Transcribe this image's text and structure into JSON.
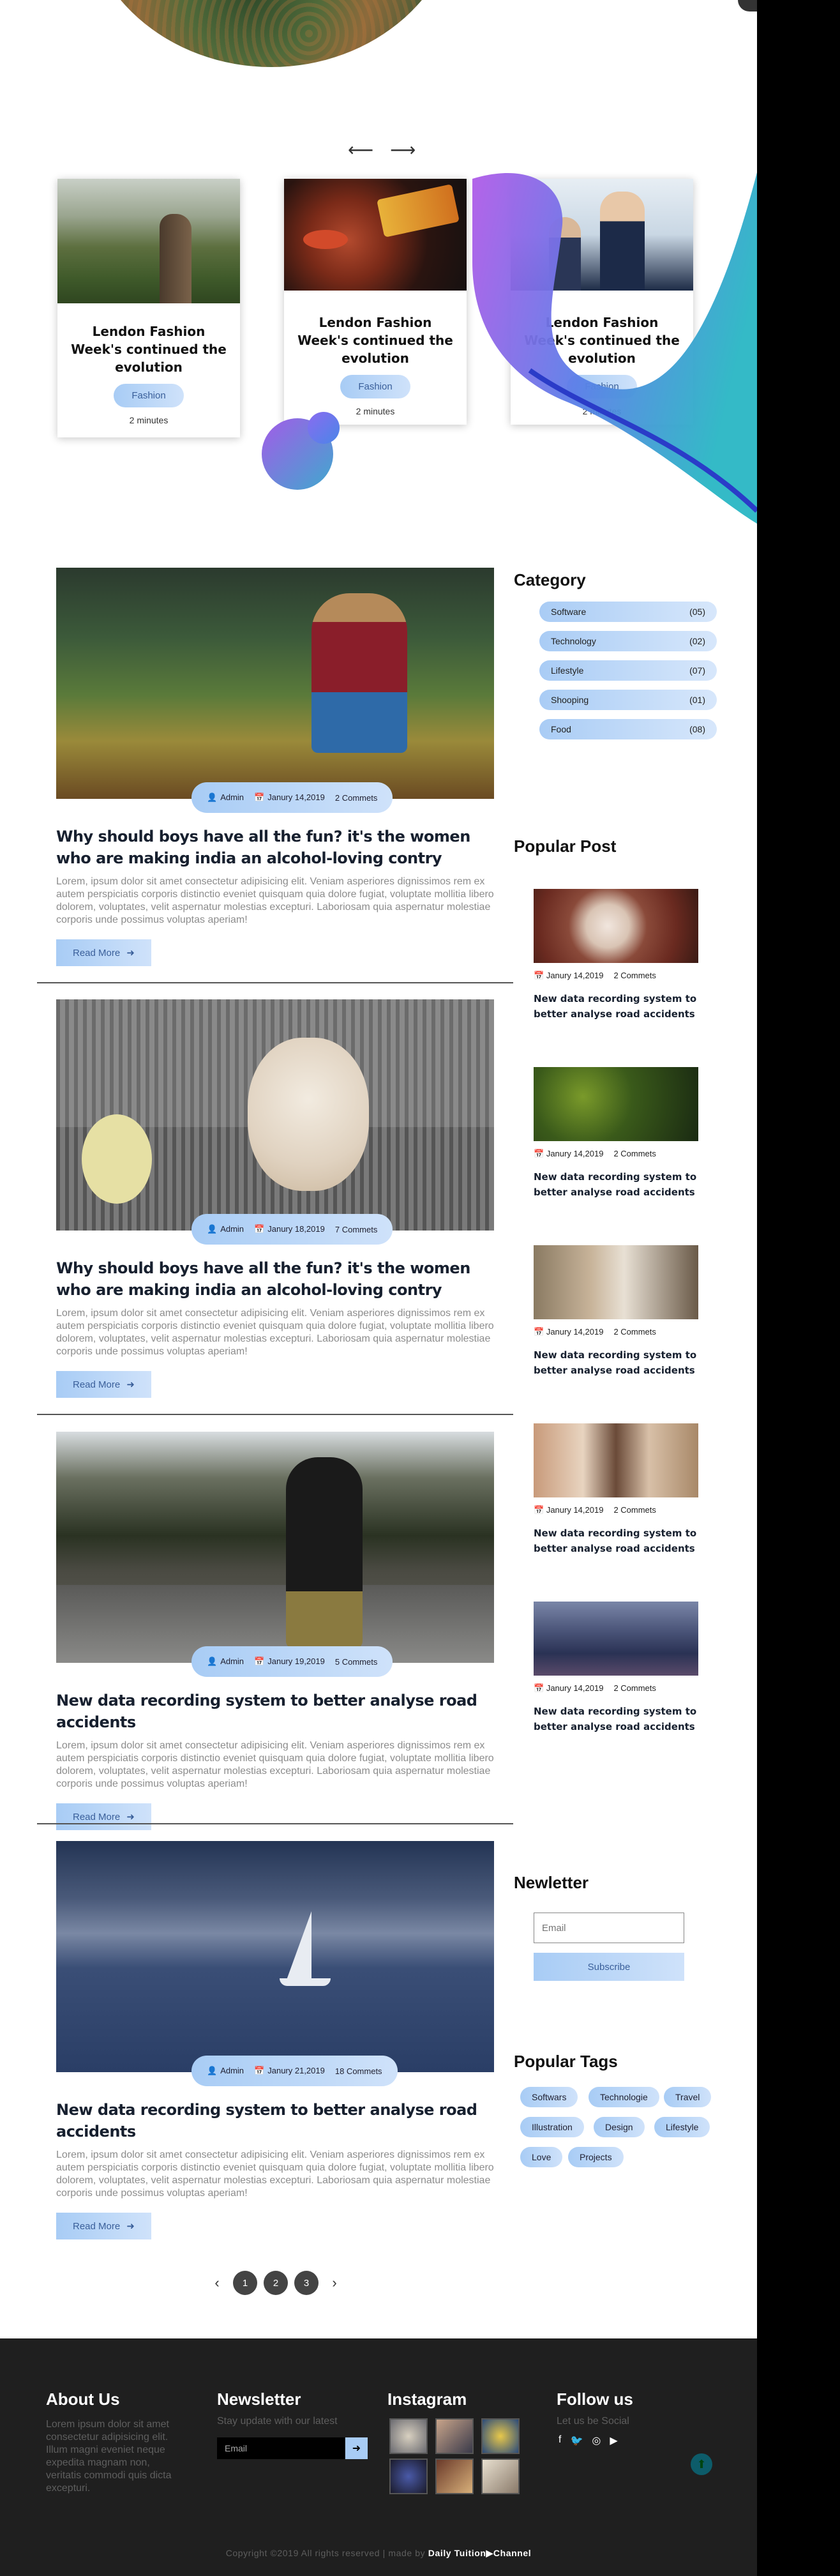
{
  "slider": {
    "prev": "⟵",
    "next": "⟶",
    "cards": [
      {
        "title": "Lendon Fashion Week's continued the evolution",
        "tag": "Fashion",
        "time": "2 minutes"
      },
      {
        "title": "Lendon Fashion Week's continued the evolution",
        "tag": "Fashion",
        "time": "2 minutes"
      },
      {
        "title": "Lendon Fashion Week's continued the evolution",
        "tag": "Fashion",
        "time": "2 minutes"
      }
    ]
  },
  "posts": [
    {
      "author": "Admin",
      "date": "Janury 14,2019",
      "comments": "2 Commets",
      "title": "Why should boys have all the fun? it's the women who are making india an alcohol-loving contry",
      "excerpt": "Lorem, ipsum dolor sit amet consectetur adipisicing elit. Veniam asperiores dignissimos rem ex autem perspiciatis corporis distinctio eveniet quisquam quia dolore fugiat, voluptate mollitia libero dolorem, voluptates, velit aspernatur molestias excepturi. Laboriosam quia aspernatur molestiae corporis unde possimus voluptas aperiam!",
      "button": "Read More"
    },
    {
      "author": "Admin",
      "date": "Janury 18,2019",
      "comments": "7 Commets",
      "title": "Why should boys have all the fun? it's the women who are making india an alcohol-loving contry",
      "excerpt": "Lorem, ipsum dolor sit amet consectetur adipisicing elit. Veniam asperiores dignissimos rem ex autem perspiciatis corporis distinctio eveniet quisquam quia dolore fugiat, voluptate mollitia libero dolorem, voluptates, velit aspernatur molestias excepturi. Laboriosam quia aspernatur molestiae corporis unde possimus voluptas aperiam!",
      "button": "Read More"
    },
    {
      "author": "Admin",
      "date": "Janury 19,2019",
      "comments": "5 Commets",
      "title": "New data recording system to better analyse road accidents",
      "excerpt": "Lorem, ipsum dolor sit amet consectetur adipisicing elit. Veniam asperiores dignissimos rem ex autem perspiciatis corporis distinctio eveniet quisquam quia dolore fugiat, voluptate mollitia libero dolorem, voluptates, velit aspernatur molestias excepturi. Laboriosam quia aspernatur molestiae corporis unde possimus voluptas aperiam!",
      "button": "Read More"
    },
    {
      "author": "Admin",
      "date": "Janury 21,2019",
      "comments": "18 Commets",
      "title": "New data recording system to better analyse road accidents",
      "excerpt": "Lorem, ipsum dolor sit amet consectetur adipisicing elit. Veniam asperiores dignissimos rem ex autem perspiciatis corporis distinctio eveniet quisquam quia dolore fugiat, voluptate mollitia libero dolorem, voluptates, velit aspernatur molestias excepturi. Laboriosam quia aspernatur molestiae corporis unde possimus voluptas aperiam!",
      "button": "Read More"
    }
  ],
  "sidebar": {
    "category_title": "Category",
    "categories": [
      {
        "name": "Software",
        "count": "(05)"
      },
      {
        "name": "Technology",
        "count": "(02)"
      },
      {
        "name": "Lifestyle",
        "count": "(07)"
      },
      {
        "name": "Shooping",
        "count": "(01)"
      },
      {
        "name": "Food",
        "count": "(08)"
      }
    ],
    "popular_title": "Popular Post",
    "popular": [
      {
        "date": "Janury 14,2019",
        "comments": "2 Commets",
        "title": "New data recording system to better analyse road accidents"
      },
      {
        "date": "Janury 14,2019",
        "comments": "2 Commets",
        "title": "New data recording system to better analyse road accidents"
      },
      {
        "date": "Janury 14,2019",
        "comments": "2 Commets",
        "title": "New data recording system to better analyse road accidents"
      },
      {
        "date": "Janury 14,2019",
        "comments": "2 Commets",
        "title": "New data recording system to better analyse road accidents"
      },
      {
        "date": "Janury 14,2019",
        "comments": "2 Commets",
        "title": "New data recording system to better analyse road accidents"
      }
    ],
    "newsletter_title": "Newletter",
    "newsletter_placeholder": "Email",
    "newsletter_button": "Subscribe",
    "tags_title": "Popular Tags",
    "tags": [
      "Softwars",
      "Technologie",
      "Travel",
      "Illustration",
      "Design",
      "Lifestyle",
      "Love",
      "Projects"
    ]
  },
  "pagination": {
    "prev": "‹",
    "pages": [
      "1",
      "2",
      "3"
    ],
    "next": "›"
  },
  "footer": {
    "about_title": "About Us",
    "about_text": "Lorem ipsum dolor sit amet consectetur adipisicing elit. Illum magni eveniet neque expedita magnam non, veritatis commodi quis dicta excepturi.",
    "newsletter_title": "Newsletter",
    "newsletter_text": "Stay update with our latest",
    "email_placeholder": "Email",
    "go": "➜",
    "instagram_title": "Instagram",
    "follow_title": "Follow us",
    "follow_text": "Let us be Social",
    "social": [
      "f",
      "🐦",
      "◎",
      "▶"
    ],
    "to_top": "⬆",
    "copyright_prefix": "Copyright ©2019 All rights reserved | made by",
    "copyright_brand": "Daily Tuition",
    "copyright_channel": "▶Channel"
  }
}
